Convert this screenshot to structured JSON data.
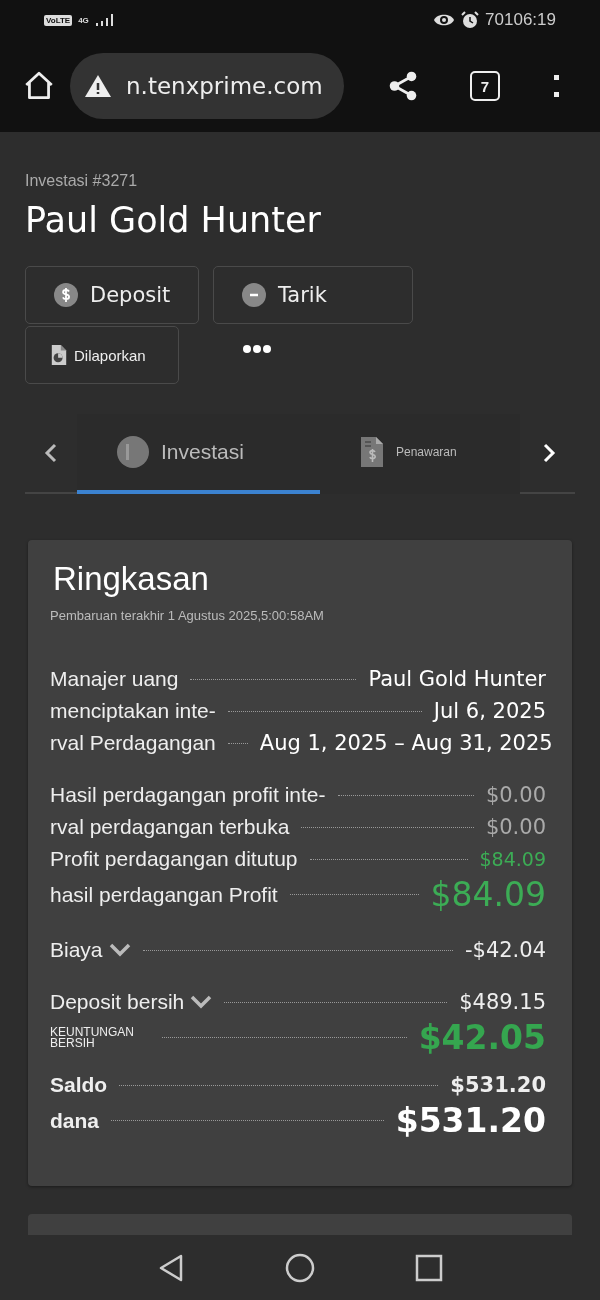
{
  "status_bar": {
    "network": "VoLTE",
    "signal_type": "4G",
    "time": "70106:19"
  },
  "browser": {
    "url": "n.tenxprime.com",
    "tab_count": "7"
  },
  "header": {
    "breadcrumb": "Investasi #3271",
    "title": "Paul Gold Hunter"
  },
  "actions": [
    {
      "label": "Deposit",
      "kind": "deposit"
    },
    {
      "label": "Tarik",
      "kind": "withdraw"
    },
    {
      "label": "Dilaporkan",
      "kind": "report"
    }
  ],
  "tabs": [
    {
      "label": "Investasi",
      "selected": true,
      "kind": "investment"
    },
    {
      "label": "Penawaran",
      "selected": false,
      "kind": "offer"
    }
  ],
  "summary": {
    "title": "Ringkasan",
    "updated": "Pembaruan terakhir 1 Agustus 2025,5:00:58AM",
    "groups": [
      [
        {
          "label": "Manajer uang",
          "value": "Paul Gold Hunter",
          "kind": "info",
          "expandable": false
        },
        {
          "label": "menciptakan inte-",
          "value": "Jul 6, 2025",
          "kind": "info",
          "expandable": false
        },
        {
          "label": "rval Perdagangan",
          "value": "Aug 1, 2025 – Aug 31, 2025",
          "kind": "info",
          "expandable": false
        }
      ],
      [
        {
          "label": "Hasil perdagangan profit inte-",
          "value": "$0.00",
          "kind": "muted",
          "expandable": false
        },
        {
          "label": "rval perdagangan terbuka",
          "value": "$0.00",
          "kind": "muted",
          "expandable": false
        },
        {
          "label": "Profit perdagangan ditutup",
          "value": "$84.09",
          "kind": "profit",
          "expandable": false
        },
        {
          "label": "hasil perdagangan Profit",
          "value": "$84.09",
          "kind": "profit-large",
          "expandable": false
        }
      ],
      [
        {
          "label": "Biaya",
          "value": "-$42.04",
          "kind": "plain",
          "expandable": true
        }
      ],
      [
        {
          "label": "Deposit bersih",
          "value": "$489.15",
          "kind": "plain",
          "expandable": true
        },
        {
          "label": "KEUNTUNGAN BERSIH",
          "value": "$42.05",
          "kind": "net",
          "expandable": false
        }
      ],
      [
        {
          "label": "Saldo",
          "value": "$531.20",
          "kind": "plain",
          "expandable": false
        },
        {
          "label": "dana",
          "value": "$531.20",
          "kind": "total",
          "expandable": false
        }
      ]
    ]
  }
}
